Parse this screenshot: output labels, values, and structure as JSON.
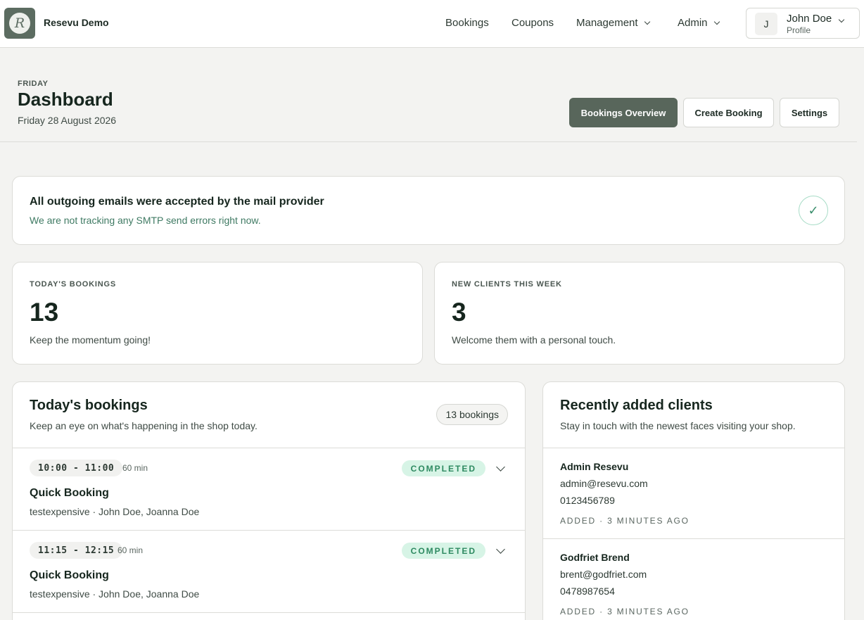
{
  "app": {
    "name": "Resevu Demo",
    "logo_letter": "R"
  },
  "nav": {
    "bookings": "Bookings",
    "coupons": "Coupons",
    "management": "Management",
    "admin": "Admin"
  },
  "profile": {
    "initial": "J",
    "name": "John Doe",
    "subtitle": "Profile"
  },
  "header": {
    "eyebrow": "FRIDAY",
    "title": "Dashboard",
    "date": "Friday 28 August 2026",
    "buttons": {
      "overview": "Bookings Overview",
      "create": "Create Booking",
      "settings": "Settings"
    }
  },
  "alert": {
    "title": "All outgoing emails were accepted by the mail provider",
    "text": "We are not tracking any SMTP send errors right now.",
    "icon": "✓"
  },
  "stats": [
    {
      "label": "TODAY'S BOOKINGS",
      "value": "13",
      "note": "Keep the momentum going!"
    },
    {
      "label": "NEW CLIENTS THIS WEEK",
      "value": "3",
      "note": "Welcome them with a personal touch."
    }
  ],
  "bookings_panel": {
    "title": "Today's bookings",
    "subtitle": "Keep an eye on what's happening in the shop today.",
    "count": "13 bookings",
    "items": [
      {
        "time": "10:00 - 11:00",
        "duration": "60 min",
        "status": "COMPLETED",
        "name": "Quick Booking",
        "meta": "testexpensive · John Doe, Joanna Doe"
      },
      {
        "time": "11:15 - 12:15",
        "duration": "60 min",
        "status": "COMPLETED",
        "name": "Quick Booking",
        "meta": "testexpensive · John Doe, Joanna Doe"
      }
    ]
  },
  "clients_panel": {
    "title": "Recently added clients",
    "subtitle": "Stay in touch with the newest faces visiting your shop.",
    "items": [
      {
        "name": "Admin Resevu",
        "email": "admin@resevu.com",
        "phone": "0123456789",
        "added": "ADDED · 3 MINUTES AGO"
      },
      {
        "name": "Godfriet Brend",
        "email": "brent@godfriet.com",
        "phone": "0478987654",
        "added": "ADDED · 3 MINUTES AGO"
      }
    ]
  },
  "colors": {
    "accent": "#58665b",
    "background": "#f3f3f1",
    "status_completed_bg": "#d7f4e6",
    "status_completed_text": "#2e8a61"
  }
}
